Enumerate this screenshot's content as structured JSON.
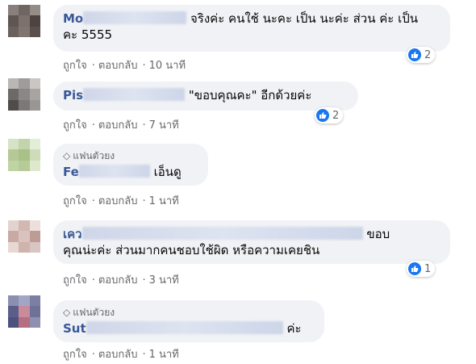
{
  "comments": [
    {
      "name_visible": "Mo",
      "text_line1": "จริงค่ะ คนใช้ นะคะ เป็น นะค่ะ ส่วน ค่ะ เป็น",
      "text_line2": "คะ 5555",
      "like": "ถูกใจ",
      "reply": "ตอบกลับ",
      "time": "10 นาที",
      "reactions": "2",
      "avatar_colors": [
        "#8a7f7c",
        "#6f6662",
        "#958b87",
        "#5f5552",
        "#7c716d",
        "#4d4441",
        "#6b605c",
        "#81766f",
        "#5a4f4b"
      ]
    },
    {
      "name_visible": "Pis",
      "text": "\"ขอบคุณคะ\" อีกด้วยค่ะ",
      "like": "ถูกใจ",
      "reply": "ตอบกลับ",
      "time": "7 นาที",
      "reactions": "2",
      "avatar_colors": [
        "#b9b6b4",
        "#9e9b99",
        "#c9c6c4",
        "#6c6968",
        "#8a8786",
        "#a7a4a2",
        "#4f4c4b",
        "#7b7877",
        "#999695"
      ]
    },
    {
      "badge": "แฟนตัวยง",
      "name_visible": "Fe",
      "text": "เอ็นดู",
      "like": "ถูกใจ",
      "reply": "ตอบกลับ",
      "time": "1 นาที",
      "avatar_colors": [
        "#d6e3c4",
        "#c2d4a9",
        "#e4edd6",
        "#b4c997",
        "#a9c187",
        "#cfdcba",
        "#c0d3a2",
        "#b7cb99",
        "#dde8cc"
      ]
    },
    {
      "name_visible": "เคว",
      "text_line1_end": "ขอบ",
      "text_line2": "คุณน่ะค่ะ ส่วนมากคนชอบใช้ผิด หรือความเคยชิน",
      "like": "ถูกใจ",
      "reply": "ตอบกลับ",
      "time": "3 นาที",
      "reactions": "1",
      "avatar_colors": [
        "#e3d3d0",
        "#d2b7b2",
        "#ecdfdc",
        "#c8a9a3",
        "#dac3be",
        "#bd9c95",
        "#e8d8d4",
        "#cfb3ad",
        "#d9c5c1"
      ]
    },
    {
      "badge": "แฟนตัวยง",
      "name_visible": "Sut",
      "text": "ค่ะ",
      "like": "ถูกใจ",
      "reply": "ตอบกลับ",
      "time": "1 นาที",
      "avatar_colors": [
        "#8b8fb0",
        "#a2a6c4",
        "#7c7fa3",
        "#5b5e8a",
        "#c98a9a",
        "#6f7298",
        "#4d517d",
        "#b46f83",
        "#8d90af"
      ]
    }
  ],
  "sep": "·",
  "badge_icon": "diamond-icon",
  "like_icon": "thumbs-up-icon",
  "colors": {
    "name": "#385898",
    "bubble": "#f0f2f5",
    "meta": "#65676b",
    "like": "#1877f2"
  }
}
